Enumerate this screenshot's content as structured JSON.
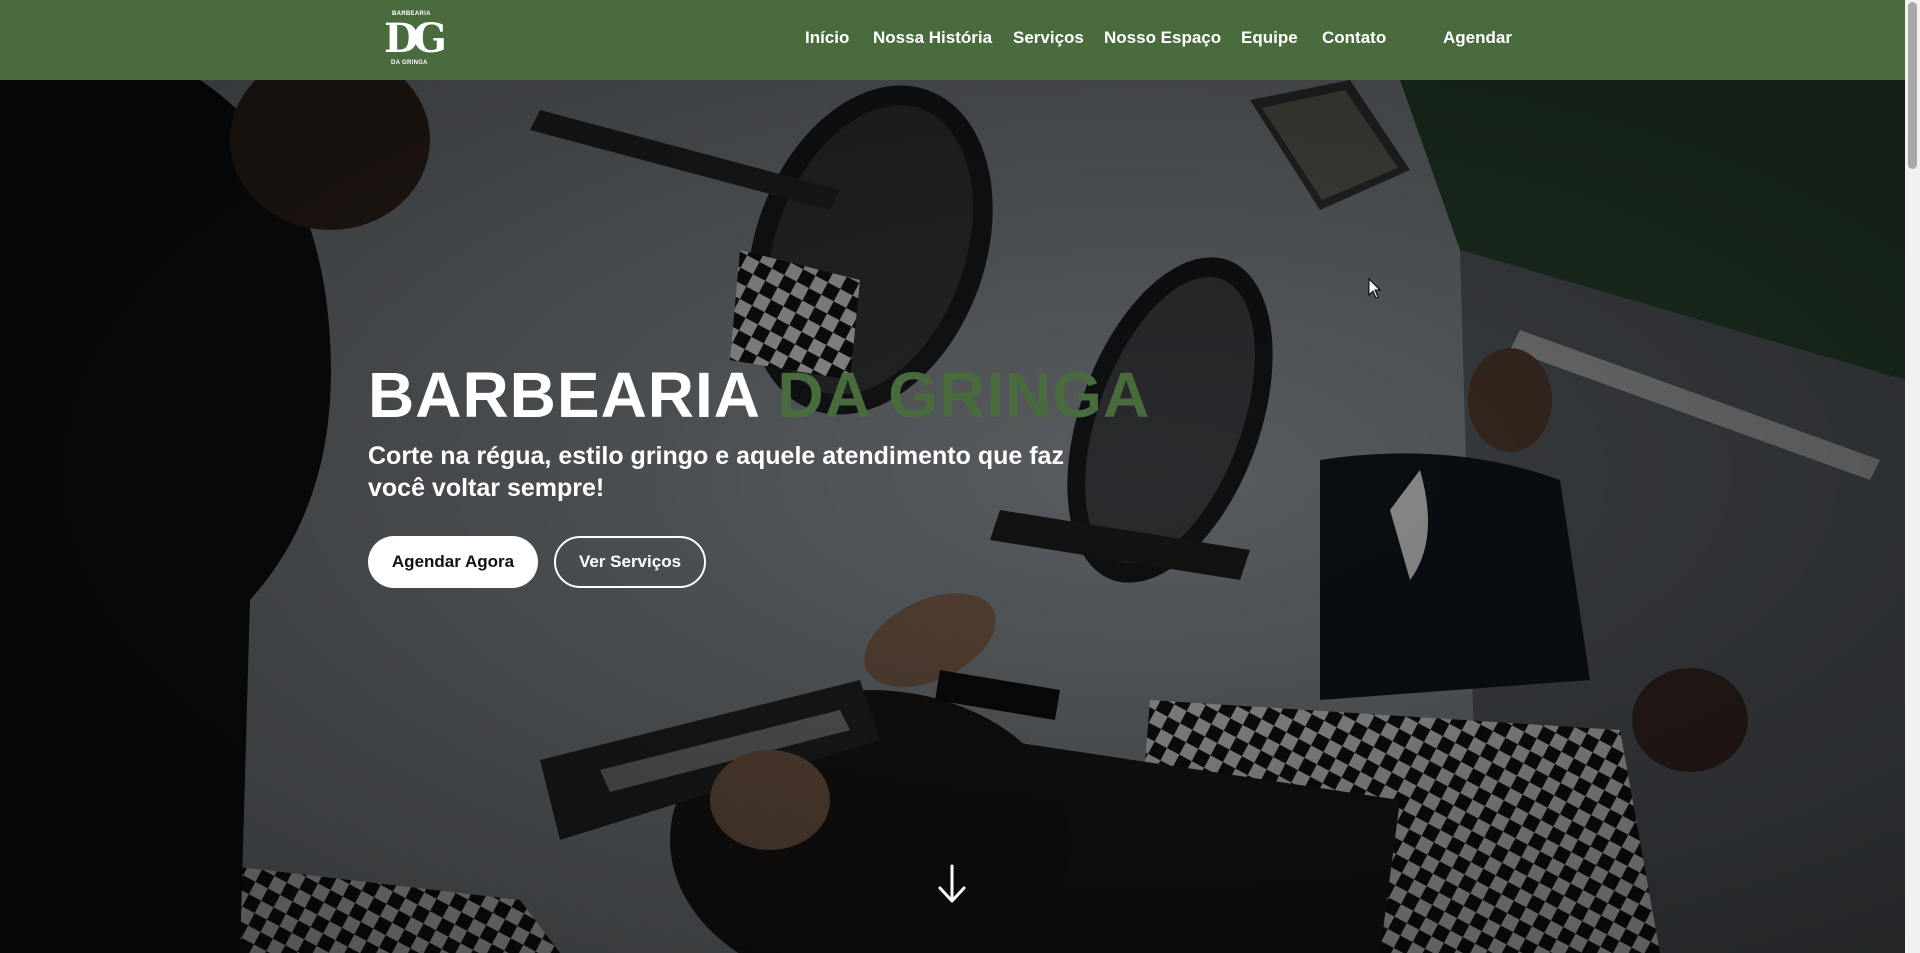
{
  "brand": {
    "logo_top": "BARBEARIA",
    "logo_mono": "DG",
    "logo_bottom": "DA GRINGA"
  },
  "nav": {
    "items": [
      {
        "label": "Início"
      },
      {
        "label": "Nossa História"
      },
      {
        "label": "Serviços"
      },
      {
        "label": "Nosso Espaço"
      },
      {
        "label": "Equipe"
      },
      {
        "label": "Contato"
      }
    ],
    "cta_label": "Agendar"
  },
  "hero": {
    "title_main": "BARBEARIA",
    "title_accent": "DA GRINGA",
    "subtitle": "Corte na régua, estilo gringo e aquele atendimento que faz você voltar sempre!",
    "primary_button": "Agendar Agora",
    "secondary_button": "Ver Serviços",
    "scroll_icon": "arrow-down-icon"
  },
  "colors": {
    "brand_green": "#4a6b3e",
    "header_bg": "#4a6b3e",
    "button_white": "#ffffff",
    "text_white": "#ffffff"
  }
}
